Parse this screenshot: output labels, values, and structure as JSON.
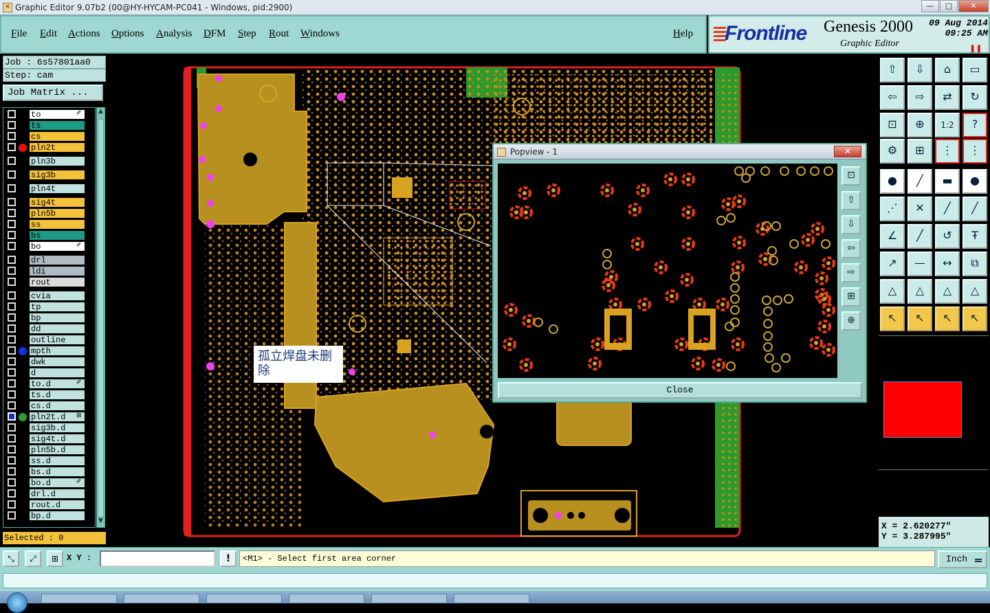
{
  "window": {
    "title": "Graphic Editor 9.07b2 (00@HY-HYCAM-PC041 - Windows, pid:2900)",
    "controls": [
      "—",
      "□",
      "✕"
    ]
  },
  "menu": {
    "items": [
      "File",
      "Edit",
      "Actions",
      "Options",
      "Analysis",
      "DFM",
      "Step",
      "Rout",
      "Windows"
    ],
    "help": "Help"
  },
  "brand": {
    "logo": "Frontline",
    "product": "Genesis 2000",
    "subtitle": "Graphic Editor",
    "date": "09 Aug 2014",
    "time": "09:25 AM",
    "pause_icon": "pause-icon"
  },
  "job": {
    "job_line": "Job : 6s57801aa0",
    "step_line": "Step: cam",
    "matrix_button": "Job Matrix ..."
  },
  "layers": [
    {
      "name": "to",
      "color": "#ffffff",
      "mark": "✐"
    },
    {
      "name": "ts",
      "color": "#1f9a84"
    },
    {
      "name": "cs",
      "color": "#f4c23a"
    },
    {
      "name": "pln2t",
      "color": "#f4c23a",
      "dot": "#e81010"
    },
    {
      "name": "pln3b",
      "color": "#bfe2df"
    },
    {
      "name": "sig3b",
      "color": "#f4c23a"
    },
    {
      "name": "pln4t",
      "color": "#bfe2df"
    },
    {
      "name": "sig4t",
      "color": "#f4c23a"
    },
    {
      "name": "pln5b",
      "color": "#f4c23a"
    },
    {
      "name": "ss",
      "color": "#f4c23a"
    },
    {
      "name": "bs",
      "color": "#1f9a84"
    },
    {
      "name": "bo",
      "color": "#ffffff",
      "mark": "✐"
    },
    {
      "name": "drl",
      "color": "#aebbc5"
    },
    {
      "name": "ldi",
      "color": "#aebbc5"
    },
    {
      "name": "rout",
      "color": "#dcdcdc"
    },
    {
      "name": "cvia",
      "color": "#bfe2df"
    },
    {
      "name": "tp",
      "color": "#bfe2df"
    },
    {
      "name": "bp",
      "color": "#bfe2df"
    },
    {
      "name": "dd",
      "color": "#bfe2df"
    },
    {
      "name": "outline",
      "color": "#bfe2df"
    },
    {
      "name": "mpth",
      "color": "#bfe2df",
      "dot": "#1030e8"
    },
    {
      "name": "dwk",
      "color": "#bfe2df"
    },
    {
      "name": "d",
      "color": "#bfe2df"
    },
    {
      "name": "to.d",
      "color": "#bfe2df",
      "mark": "✐"
    },
    {
      "name": "ts.d",
      "color": "#bfe2df"
    },
    {
      "name": "cs.d",
      "color": "#bfe2df"
    },
    {
      "name": "pln2t.d",
      "color": "#bfe2df",
      "dot": "#2aa02a",
      "mark": "⊞",
      "active": true
    },
    {
      "name": "sig3b.d",
      "color": "#bfe2df"
    },
    {
      "name": "sig4t.d",
      "color": "#bfe2df"
    },
    {
      "name": "pln5b.d",
      "color": "#bfe2df"
    },
    {
      "name": "ss.d",
      "color": "#bfe2df"
    },
    {
      "name": "bs.d",
      "color": "#bfe2df"
    },
    {
      "name": "bo.d",
      "color": "#bfe2df",
      "mark": "✐"
    },
    {
      "name": "drl.d",
      "color": "#bfe2df"
    },
    {
      "name": "rout.d",
      "color": "#bfe2df"
    },
    {
      "name": "bp.d",
      "color": "#bfe2df"
    }
  ],
  "selected": "Selected : 0",
  "annotation": "孤立焊盘未删除",
  "popview": {
    "title": "Popview - 1",
    "close_label": "Close",
    "tools": [
      "zoom-fit-icon",
      "zoom-in-icon",
      "zoom-out-icon",
      "pan-left-icon",
      "pan-right-icon",
      "zoom-area-icon",
      "zoom-home-icon"
    ]
  },
  "toolbar": {
    "rows": [
      [
        "zoom-in-page-icon",
        "zoom-out-page-icon",
        "home-icon",
        "layout-icon"
      ],
      [
        "pan-left-icon",
        "pan-right-icon",
        "flip-icon",
        "redraw-icon"
      ],
      [
        "fit-screen-icon",
        "fit-profile-icon",
        "scale-1-2-icon",
        "help-icon"
      ],
      [
        "settings-icon",
        "grid-icon",
        "snap-icon",
        "snap-alt-icon"
      ],
      [
        "feature-pad-icon",
        "draw-line-icon",
        "ruler-icon",
        "round-pad-icon"
      ],
      [
        "connect-icon",
        "cross-icon",
        "line-tool-icon",
        "line-tool-alt-icon"
      ],
      [
        "angle-icon",
        "slash-icon",
        "arc-icon",
        "text-tool-icon"
      ],
      [
        "move-icon",
        "minus-icon",
        "resize-icon",
        "copy-icon"
      ],
      [
        "measure-icon",
        "measure-2-icon",
        "measure-3-icon",
        "measure-4-icon"
      ],
      [
        "select-icon",
        "select-box-icon",
        "select-touch-icon",
        "select-multi-icon"
      ]
    ]
  },
  "coords": {
    "x": "X = 2.620277\"",
    "y": "Y = 3.287995\""
  },
  "status": {
    "xy_label": "X Y :",
    "info": "!",
    "message": "<M1> - Select first area corner",
    "units": "Inch"
  }
}
